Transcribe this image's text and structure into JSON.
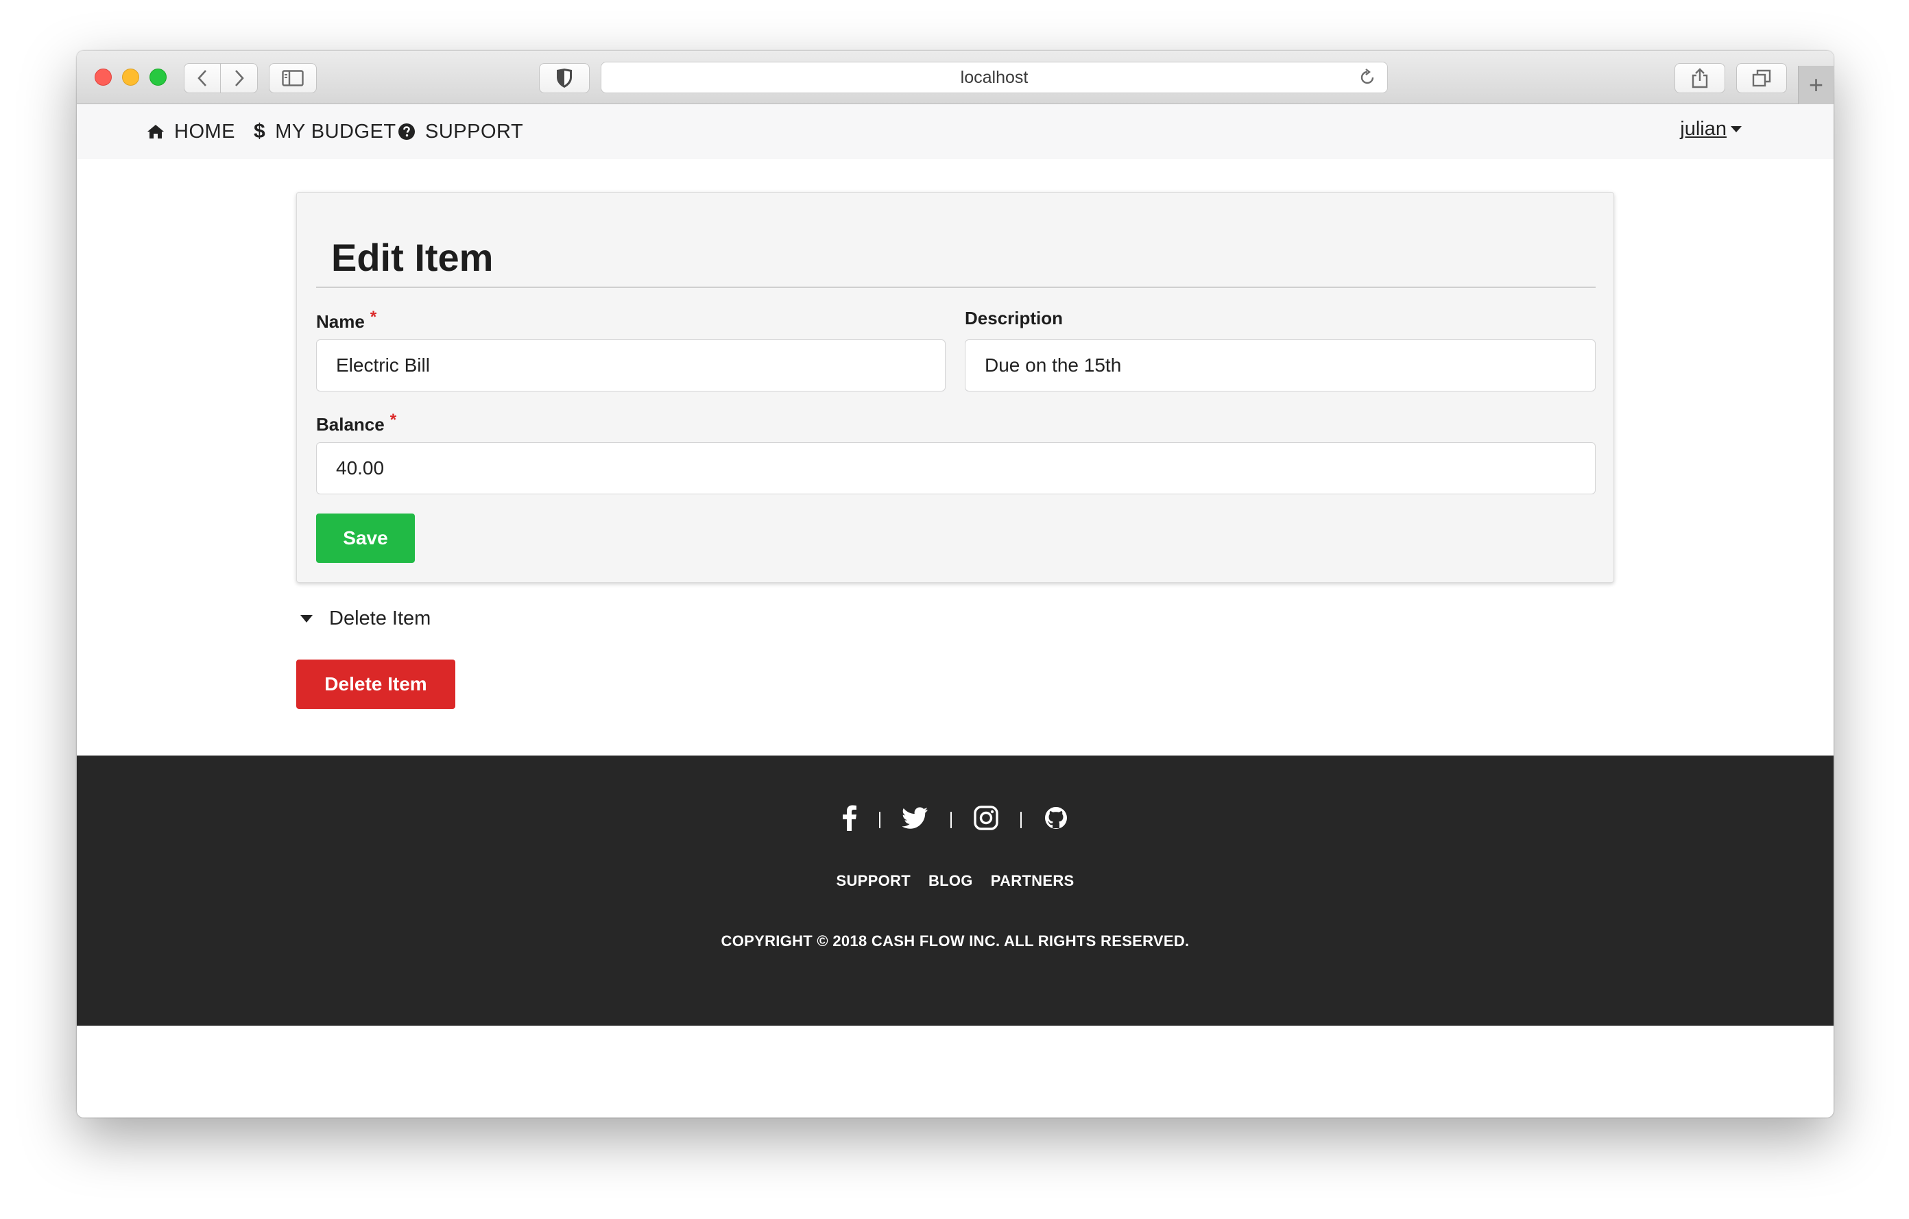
{
  "browser": {
    "url": "localhost",
    "new_tab_symbol": "+"
  },
  "navbar": {
    "items": [
      {
        "label": "HOME",
        "icon": "home-icon"
      },
      {
        "label": "MY BUDGET",
        "icon": "dollar-icon"
      },
      {
        "label": "SUPPORT",
        "icon": "question-circle-icon"
      }
    ],
    "user": "julian"
  },
  "form": {
    "title": "Edit Item",
    "name": {
      "label": "Name",
      "required_mark": "*",
      "value": "Electric Bill"
    },
    "description": {
      "label": "Description",
      "value": "Due on the 15th"
    },
    "balance": {
      "label": "Balance",
      "required_mark": "*",
      "value": "40.00"
    },
    "save_label": "Save"
  },
  "delete_section": {
    "toggle_label": "Delete Item",
    "button_label": "Delete Item"
  },
  "footer": {
    "socials": [
      "facebook-icon",
      "twitter-icon",
      "instagram-icon",
      "github-icon"
    ],
    "links": [
      "SUPPORT",
      "BLOG",
      "PARTNERS"
    ],
    "copyright": "COPYRIGHT © 2018 CASH FLOW INC. ALL RIGHTS RESERVED."
  },
  "colors": {
    "save": "#21ba45",
    "delete": "#db2828",
    "footer_bg": "#272727"
  }
}
